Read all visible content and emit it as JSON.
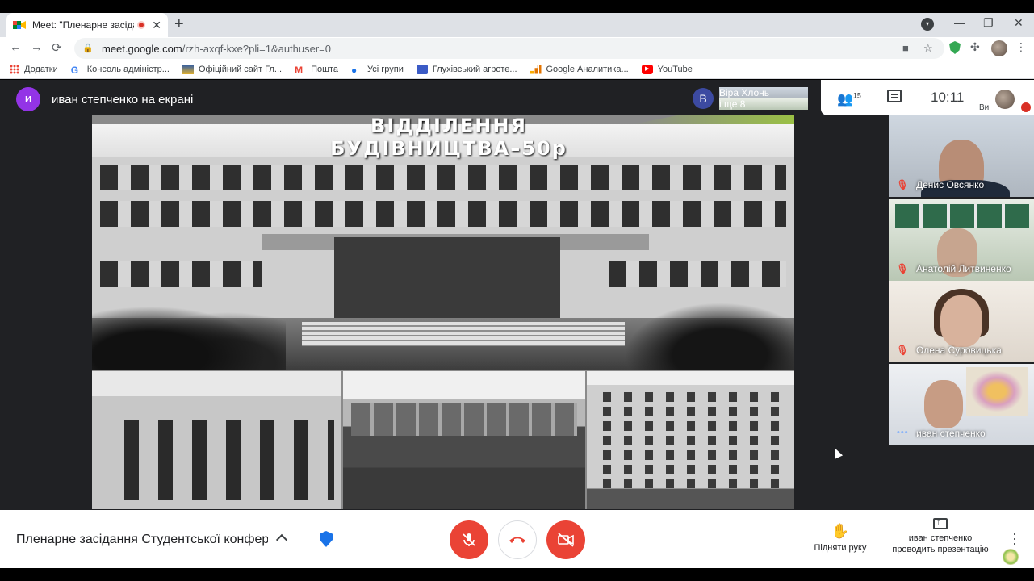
{
  "tab": {
    "title": "Meet: \"Пленарне засідання",
    "close": "✕",
    "new_tab": "+"
  },
  "window": {
    "minimize": "—",
    "maximize": "❐",
    "close": "✕"
  },
  "toolbar": {
    "back": "←",
    "forward": "→",
    "reload": "⟳",
    "url_host": "meet.google.com",
    "url_path": "/rzh-axqf-kxe?pli=1&authuser=0"
  },
  "bookmarks": [
    {
      "label": "Додатки",
      "icon": "apps-grid-icon"
    },
    {
      "label": "Консоль адміністр...",
      "icon": "google-icon"
    },
    {
      "label": "Офіційний сайт Гл...",
      "icon": "site-icon"
    },
    {
      "label": "Пошта",
      "icon": "gmail-icon"
    },
    {
      "label": "Усі групи",
      "icon": "groups-icon"
    },
    {
      "label": "Глухівський агроте...",
      "icon": "site-icon"
    },
    {
      "label": "Google Аналитика...",
      "icon": "analytics-icon"
    },
    {
      "label": "YouTube",
      "icon": "youtube-icon"
    }
  ],
  "meet": {
    "presenter": {
      "avatar_letter": "и",
      "label": "иван степченко на екрані"
    },
    "slide": {
      "title": "ВІДДІЛЕННЯ БУДІВНИЦТВА–50р"
    },
    "more_participants": {
      "avatar_letter": "В",
      "line1": "Віра Хлонь",
      "line2": "і ще 8"
    },
    "info": {
      "participant_count": "15",
      "time": "10:11",
      "self_label": "Ви"
    },
    "participants": [
      {
        "name": "Денис Овсянко",
        "muted": true
      },
      {
        "name": "Анатолій Литвиненко",
        "muted": true
      },
      {
        "name": "Олена Суровицька",
        "muted": true
      },
      {
        "name": "иван степченко",
        "muted": false
      }
    ]
  },
  "bottom": {
    "meeting_title": "Пленарне засідання Студентської конфер...",
    "raise_hand": "Підняти руку",
    "presenting_line1": "иван степченко",
    "presenting_line2": "проводить презентацію"
  },
  "colors": {
    "meet_bg": "#202124",
    "danger": "#ea4335",
    "accent": "#1a73e8",
    "avatar_purple": "#9334e6"
  }
}
